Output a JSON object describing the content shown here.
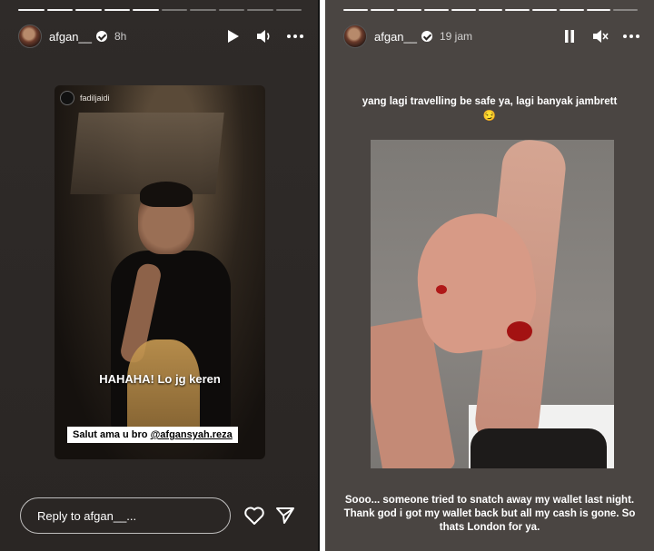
{
  "left_story": {
    "username": "afgan__",
    "time": "8h",
    "reshare": {
      "username": "fadiljaidi",
      "overlay_text": "HAHAHA! Lo jg keren",
      "caption_prefix": "Salut ama u bro ",
      "caption_mention": "@afgansyah.reza"
    },
    "reply_placeholder": "Reply to afgan__..."
  },
  "right_story": {
    "username": "afgan__",
    "time": "19 jam",
    "caption_top": "yang lagi travelling be safe ya, lagi banyak jambrett 😏",
    "caption_bottom": "Sooo... someone tried to snatch away my wallet last night. Thank god i got my wallet back but all my cash is gone. So thats London for ya."
  },
  "icons": {
    "play": "play-icon",
    "volume": "volume-icon",
    "mute": "mute-icon",
    "pause": "pause-icon",
    "more": "more-icon",
    "heart": "heart-icon",
    "send": "send-icon",
    "verified": "verified-badge-icon"
  },
  "colors": {
    "left_background": "#2c2826",
    "right_background": "#4a4542",
    "text": "#ffffff"
  }
}
